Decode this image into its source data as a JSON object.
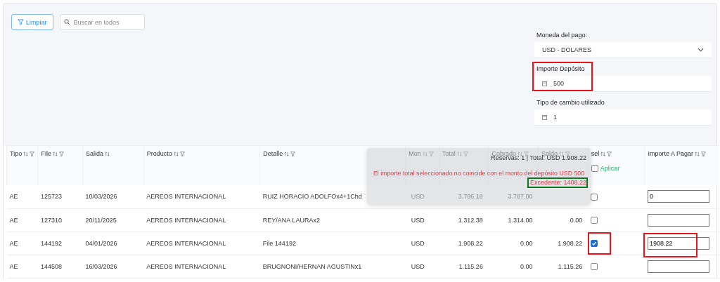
{
  "toolbar": {
    "clear_button": "Limpiar",
    "search": {
      "placeholder": "Buscar en todos"
    }
  },
  "payment": {
    "currency": {
      "label": "Moneda del pago:",
      "value": "USD - DOLARES"
    },
    "deposit": {
      "label": "Importe Depósito",
      "value": "500",
      "highlighted": true
    },
    "exchange_rate": {
      "label": "Tipo de cambio utilizado",
      "value": "1"
    }
  },
  "table": {
    "columns": [
      {
        "label": "Tipo",
        "sortable": true,
        "filterable": true
      },
      {
        "label": "File",
        "sortable": true,
        "filterable": true
      },
      {
        "label": "Salida",
        "sortable": true,
        "filterable": false
      },
      {
        "label": "Producto",
        "sortable": true,
        "filterable": true
      },
      {
        "label": "Detalle",
        "sortable": true,
        "filterable": true
      },
      {
        "label": "Mon",
        "sortable": true,
        "filterable": true
      },
      {
        "label": "Total",
        "sortable": true,
        "filterable": true
      },
      {
        "label": "Cobrado",
        "sortable": true,
        "filterable": true
      },
      {
        "label": "Saldo",
        "sortable": true,
        "filterable": true
      },
      {
        "label": "sel",
        "sortable": true,
        "filterable": true
      },
      {
        "label": "Importe A Pagar",
        "sortable": true,
        "filterable": true
      }
    ],
    "apply_label": "Aplicar",
    "apply_checked": false,
    "rows": [
      {
        "tipo": "AE",
        "file": "125723",
        "salida": "10/03/2026",
        "producto": "AEREOS INTERNACIONAL",
        "detalle": "RUIZ HORACIO ADOLFOx4+1Chd",
        "mon": "USD",
        "total": "3.786.18",
        "cobrado": "3.787.00",
        "selected": false,
        "amount": "0"
      },
      {
        "tipo": "AE",
        "file": "127310",
        "salida": "20/11/2025",
        "producto": "AEREOS INTERNACIONAL",
        "detalle": "REY/ANA LAURAx2",
        "mon": "USD",
        "total": "1.312.38",
        "cobrado": "1.314.00",
        "saldo": "0.00",
        "selected": false
      },
      {
        "tipo": "AE",
        "file": "144192",
        "salida": "04/01/2026",
        "producto": "AEREOS INTERNACIONAL",
        "detalle": "File 144192",
        "mon": "USD",
        "total": "1.908.22",
        "cobrado": "0.00",
        "saldo": "1.908.22",
        "selected": true,
        "amount": "1908.22",
        "highlighted": true
      },
      {
        "tipo": "AE",
        "file": "144508",
        "salida": "16/03/2026",
        "producto": "AEREOS INTERNACIONAL",
        "detalle": "BRUGNONI/HERNAN AGUSTINx1",
        "mon": "USD",
        "total": "1.115.26",
        "cobrado": "0.00",
        "saldo": "1.115.26",
        "selected": false
      }
    ]
  },
  "toast": {
    "summary": "Reservas: 1 | Total: USD 1.908.22",
    "error": "El importe total seleccionado no coincide con el monto del depósito USD 500",
    "excess": "Excedente: 1408.22",
    "excess_highlighted": true
  }
}
